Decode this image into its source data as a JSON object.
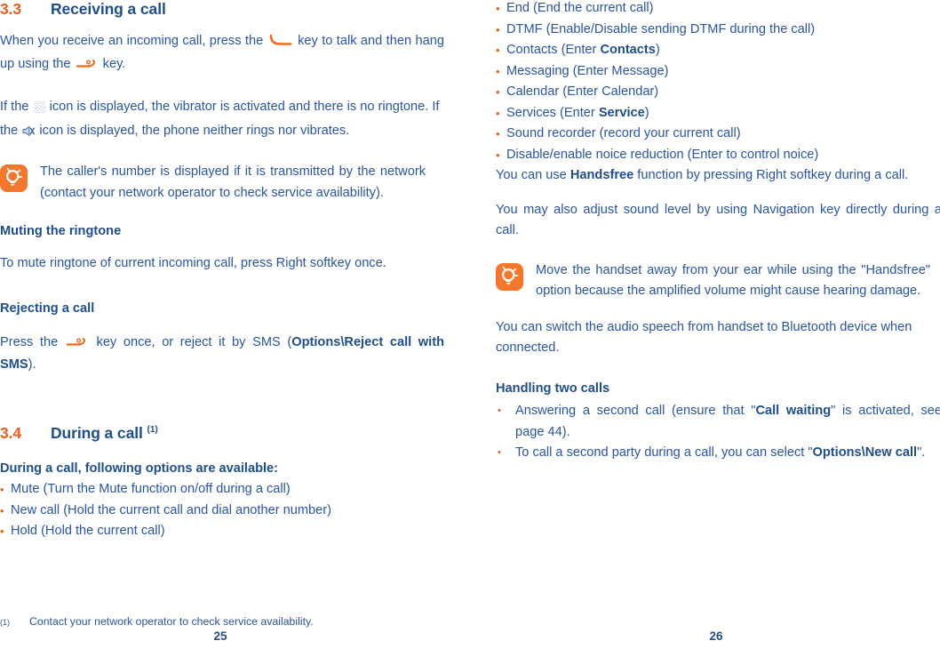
{
  "colors": {
    "accent_orange": "#e8601c",
    "tip_icon_bg": "#f4772e",
    "heading_blue": "#1f4e8c",
    "body_blue": "#2a55a3"
  },
  "left_column": {
    "section_33": {
      "number": "3.3",
      "title": "Receiving a call"
    },
    "para_incoming_1": "When you receive an incoming call, press the",
    "para_incoming_2": "key to talk and then hang up using the",
    "para_incoming_3": "key.",
    "para_vibrate_1": "If the",
    "para_vibrate_2": "icon is displayed, the vibrator is activated and there is no ringtone. If the",
    "para_vibrate_3": "icon is displayed, the phone neither rings nor vibrates.",
    "tip_caller": "The caller's number is displayed if it is transmitted by the network (contact your network operator to check service availability).",
    "muting_heading": "Muting the ringtone",
    "muting_text": "To mute ringtone of current incoming call, press Right softkey once.",
    "rejecting_heading": "Rejecting a call",
    "reject_1": "Press the",
    "reject_2": "key once, or reject it by SMS (",
    "reject_bold": "Options\\Reject call with SMS",
    "reject_3": ").",
    "section_34": {
      "number": "3.4",
      "title": "During a call",
      "superscript": "(1)"
    },
    "during_call_heading": "During a call, following options are available:",
    "during_call_options": [
      "Mute (Turn the Mute function on/off during a call)",
      "New call (Hold the current call and dial another number)",
      "Hold (Hold the current call)"
    ],
    "footnote": {
      "mark": "(1)",
      "text": "Contact your network operator to check service availability."
    },
    "page_number": "25"
  },
  "right_column": {
    "options_continued": [
      {
        "plain": "End (End the current call)"
      },
      {
        "plain": "DTMF (Enable/Disable sending DTMF during the call)"
      },
      {
        "prefix": "Contacts (Enter ",
        "bold": "Contacts",
        "suffix": ")"
      },
      {
        "plain": "Messaging (Enter Message)"
      },
      {
        "plain": "Calendar (Enter Calendar)"
      },
      {
        "prefix": "Services (Enter ",
        "bold": "Service",
        "suffix": ")"
      },
      {
        "plain": "Sound recorder (record your current call)"
      },
      {
        "plain": "Disable/enable noice reduction (Enter to control noice)"
      }
    ],
    "handsfree_1": "You can use ",
    "handsfree_bold": "Handsfree",
    "handsfree_2": " function by pressing Right softkey during a call.",
    "sound_level": "You may also adjust sound level by using Navigation key directly during a call.",
    "tip_handsfree": "Move the handset away from your ear while using the \"Handsfree\" option because the amplified volume might cause hearing damage.",
    "bluetooth_text": "You can switch the audio speech from handset to Bluetooth device when connected.",
    "handling_heading": "Handling two calls",
    "handling_items": [
      {
        "prefix": "Answering a second call (ensure that \"",
        "bold": "Call waiting",
        "suffix": "\" is activated, see page 44)."
      },
      {
        "prefix": "To call a second party during a call, you can select \"",
        "bold": "Options\\New call",
        "suffix": "\"."
      }
    ],
    "page_number": "26"
  },
  "icons": {
    "tip": "lightbulb-icon",
    "talk_key": "call-answer-key-icon",
    "hangup_key": "call-end-key-icon",
    "vibrate": "vibrate-icon",
    "silent": "silent-mute-icon"
  }
}
